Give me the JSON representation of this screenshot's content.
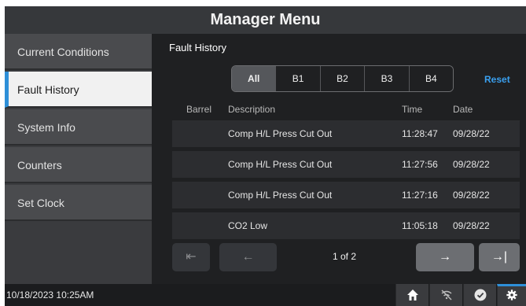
{
  "title": "Manager Menu",
  "sidebar": {
    "items": [
      {
        "label": "Current Conditions"
      },
      {
        "label": "Fault History"
      },
      {
        "label": "System Info"
      },
      {
        "label": "Counters"
      },
      {
        "label": "Set Clock"
      }
    ],
    "active": "Fault History"
  },
  "main": {
    "title": "Fault History",
    "filters": [
      "All",
      "B1",
      "B2",
      "B3",
      "B4"
    ],
    "active_filter": "All",
    "reset_label": "Reset",
    "columns": {
      "barrel": "Barrel",
      "description": "Description",
      "time": "Time",
      "date": "Date"
    },
    "rows": [
      {
        "barrel": "",
        "description": "Comp H/L Press Cut Out",
        "time": "11:28:47",
        "date": "09/28/22"
      },
      {
        "barrel": "",
        "description": "Comp H/L Press Cut Out",
        "time": "11:27:56",
        "date": "09/28/22"
      },
      {
        "barrel": "",
        "description": "Comp H/L Press Cut Out",
        "time": "11:27:16",
        "date": "09/28/22"
      },
      {
        "barrel": "",
        "description": "CO2 Low",
        "time": "11:05:18",
        "date": "09/28/22"
      }
    ],
    "pager": {
      "first_icon": "⇤",
      "prev_icon": "←",
      "page_text": "1 of 2",
      "next_icon": "→",
      "last_icon": "→|"
    }
  },
  "footer": {
    "datetime": "10/18/2023 10:25AM",
    "icons": [
      "home-icon",
      "signal-off-icon",
      "check-circle-icon",
      "gear-icon"
    ],
    "selected_icon": "gear-icon"
  },
  "colors": {
    "accent": "#2e8fd8",
    "link": "#3aa0f0",
    "background": "#1b1c1e"
  }
}
